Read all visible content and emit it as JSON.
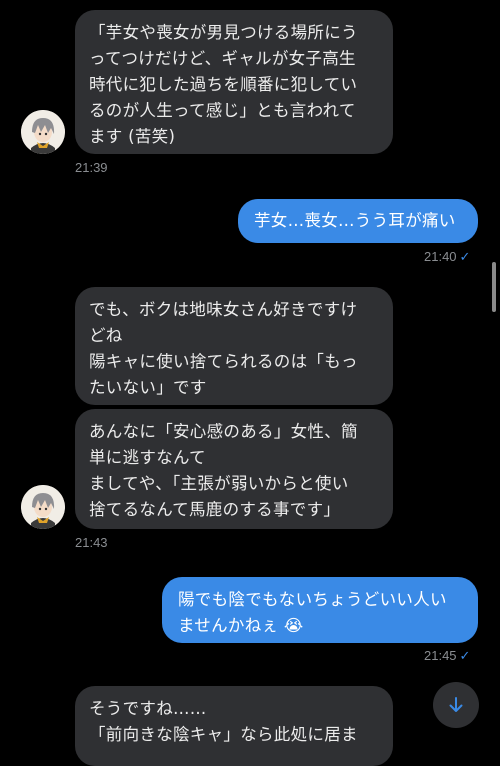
{
  "messages": [
    {
      "lines": [
        "「芋女や喪女が男見つける場所にう",
        "ってつけだけど、ギャルが女子高生",
        "時代に犯した過ちを順番に犯してい",
        "るのが人生って感じ」とも言われて",
        "ます (苦笑)"
      ],
      "time": "21:39"
    },
    {
      "lines": [
        "芋女…喪女…うう耳が痛い"
      ],
      "time": "21:40"
    },
    {
      "lines": [
        "でも、ボクは地味女さん好きですけ",
        "どね",
        "陽キャに使い捨てられるのは「もっ",
        "たいない」です"
      ]
    },
    {
      "lines": [
        "あんなに「安心感のある」女性、簡",
        "単に逃すなんて",
        "ましてや、「主張が弱いからと使い",
        "捨てるなんて馬鹿のする事です」"
      ],
      "time": "21:43"
    },
    {
      "lines": [
        "陽でも陰でもないちょうどいい人い",
        "ませんかねぇ 😭"
      ],
      "time": "21:45"
    },
    {
      "lines": [
        "そうですね……",
        "「前向きな陰キャ」なら此処に居ま"
      ]
    }
  ],
  "icons": {
    "read_check": "✓",
    "scroll_down": "arrow-down-icon",
    "avatar": "bot-avatar"
  },
  "colors": {
    "background": "#000000",
    "incoming_bubble": "#2f3033",
    "outgoing_bubble": "#3a8ae6",
    "timestamp": "#8a8d91"
  }
}
